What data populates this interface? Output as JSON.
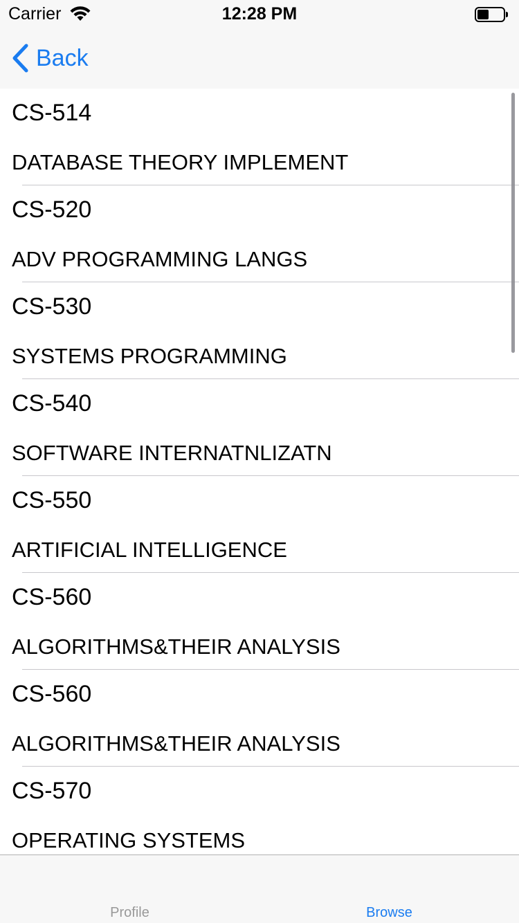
{
  "status_bar": {
    "carrier": "Carrier",
    "time": "12:28 PM",
    "wifi_icon": "wifi-icon",
    "battery_icon": "battery-icon"
  },
  "nav_bar": {
    "back_label": "Back",
    "back_icon": "chevron-left-icon",
    "accent_color": "#1a7cf0"
  },
  "courses": [
    {
      "code": "CS-514",
      "title": "DATABASE THEORY IMPLEMENT"
    },
    {
      "code": "CS-520",
      "title": "ADV PROGRAMMING LANGS"
    },
    {
      "code": "CS-530",
      "title": "SYSTEMS PROGRAMMING"
    },
    {
      "code": "CS-540",
      "title": "SOFTWARE INTERNATNLIZATN"
    },
    {
      "code": "CS-550",
      "title": "ARTIFICIAL INTELLIGENCE"
    },
    {
      "code": "CS-560",
      "title": "ALGORITHMS&THEIR ANALYSIS"
    },
    {
      "code": "CS-560",
      "title": "ALGORITHMS&THEIR ANALYSIS"
    },
    {
      "code": "CS-570",
      "title": "OPERATING SYSTEMS"
    }
  ],
  "tab_bar": {
    "tabs": [
      {
        "label": "Profile",
        "selected": false
      },
      {
        "label": "Browse",
        "selected": true
      }
    ],
    "selected_color": "#1a7cf0",
    "unselected_color": "#999999"
  }
}
